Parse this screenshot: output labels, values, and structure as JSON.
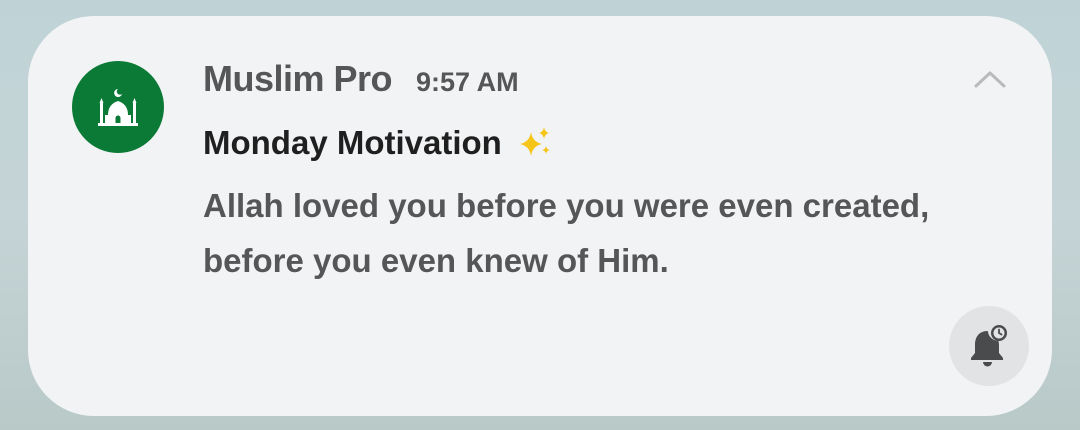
{
  "notification": {
    "app_name": "Muslim Pro",
    "time": "9:57 AM",
    "title": "Monday Motivation",
    "title_emoji": "sparkles",
    "body_line1": "Allah loved you before you were even created,",
    "body_line2": "before you even knew of Him.",
    "icons": {
      "app": "mosque-icon",
      "collapse": "chevron-up-icon",
      "snooze": "snooze-bell-icon"
    },
    "colors": {
      "app_icon_bg": "#0b7a36",
      "card_bg": "#f2f3f4",
      "sparkle": "#f5c518"
    }
  }
}
